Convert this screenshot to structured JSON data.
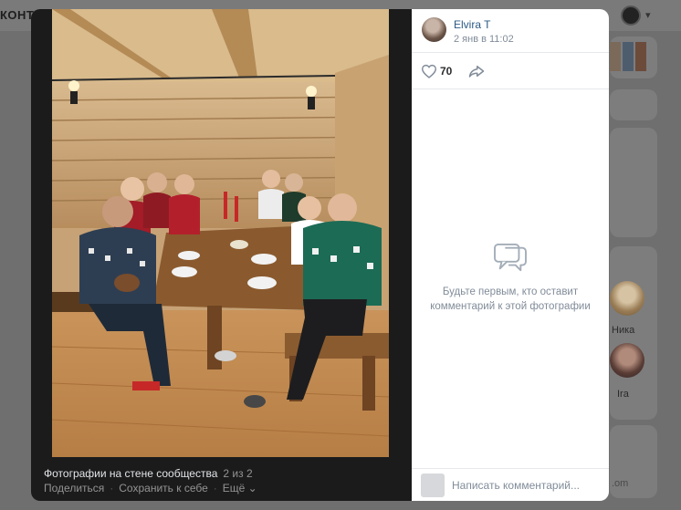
{
  "background": {
    "logo": "КОНТ",
    "friends": [
      {
        "name": "Ника"
      },
      {
        "name": "Ira"
      }
    ],
    "misc_text": ".om"
  },
  "viewer": {
    "caption_title": "Фотографии на стене сообщества",
    "caption_counter": "2 из 2",
    "actions": {
      "share": "Поделиться",
      "save": "Сохранить к себе",
      "more": "Ещё"
    },
    "separator": "·",
    "more_icon": "chevron-down-icon"
  },
  "panel": {
    "author": "Elvira T",
    "date": "2 янв в 11:02",
    "likes": "70",
    "like_icon": "heart-icon",
    "share_icon": "share-arrow-icon",
    "empty_line1": "Будьте первым, кто оставит",
    "empty_line2": "комментарий к этой фотографии",
    "comment_placeholder": "Написать комментарий..."
  },
  "colors": {
    "link": "#2a5885",
    "muted": "#818c99",
    "viewer_bg": "#1b1b1c"
  }
}
